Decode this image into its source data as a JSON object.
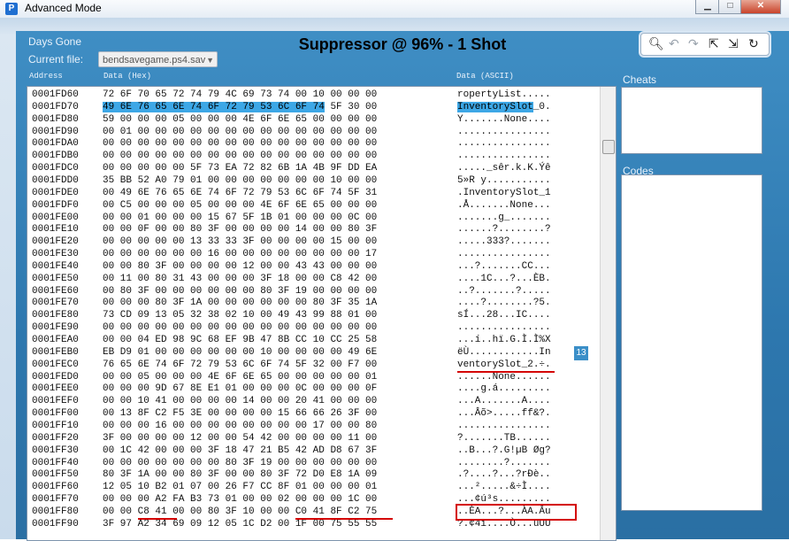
{
  "window": {
    "title": "Advanced Mode",
    "icon": "app-logo-icon"
  },
  "header": {
    "game": "Days Gone",
    "heading": "Suppressor @ 96% - 1 Shot",
    "current_file_label": "Current file:",
    "current_file_value": "bendsavegame.ps4.sav"
  },
  "toolbar": {
    "icons": [
      "search-icon",
      "undo-icon",
      "redo-icon",
      "import-icon",
      "export-icon",
      "refresh-icon"
    ]
  },
  "columns": {
    "address": "Address",
    "hex": "Data (Hex)",
    "ascii": "Data (ASCII)"
  },
  "hex_rows": [
    {
      "addr": "0001FD60",
      "hex": "72 6F 70 65 72 74 79 4C 69 73 74 00 10 00 00 00",
      "ascii": "ropertyList....."
    },
    {
      "addr": "0001FD70",
      "hex": "49 6E 76 65 6E 74 6F 72 79 53 6C 6F 74 5F 30 00",
      "ascii": "InventorySlot_0."
    },
    {
      "addr": "0001FD80",
      "hex": "59 00 00 00 05 00 00 00 4E 6F 6E 65 00 00 00 00",
      "ascii": "Y.......None...."
    },
    {
      "addr": "0001FD90",
      "hex": "00 01 00 00 00 00 00 00 00 00 00 00 00 00 00 00",
      "ascii": "................"
    },
    {
      "addr": "0001FDA0",
      "hex": "00 00 00 00 00 00 00 00 00 00 00 00 00 00 00 00",
      "ascii": "................"
    },
    {
      "addr": "0001FDB0",
      "hex": "00 00 00 00 00 00 00 00 00 00 00 00 00 00 00 00",
      "ascii": "................"
    },
    {
      "addr": "0001FDC0",
      "hex": "00 00 00 00 00 5F 73 EA 72 82 6B 1A 4B 9F DD EA",
      "ascii": "....._sêr.k.K.Ýê"
    },
    {
      "addr": "0001FDD0",
      "hex": "35 BB 52 A0 79 01 00 00 00 00 00 00 00 10 00 00",
      "ascii": "5»R y..........."
    },
    {
      "addr": "0001FDE0",
      "hex": "00 49 6E 76 65 6E 74 6F 72 79 53 6C 6F 74 5F 31",
      "ascii": ".InventorySlot_1"
    },
    {
      "addr": "0001FDF0",
      "hex": "00 C5 00 00 00 05 00 00 00 4E 6F 6E 65 00 00 00",
      "ascii": ".Å.......None..."
    },
    {
      "addr": "0001FE00",
      "hex": "00 00 01 00 00 00 15 67 5F 1B 01 00 00 00 0C 00",
      "ascii": ".......g_......."
    },
    {
      "addr": "0001FE10",
      "hex": "00 00 0F 00 00 80 3F 00 00 00 00 14 00 00 80 3F",
      "ascii": "......?........?"
    },
    {
      "addr": "0001FE20",
      "hex": "00 00 00 00 00 13 33 33 3F 00 00 00 00 15 00 00",
      "ascii": ".....333?......."
    },
    {
      "addr": "0001FE30",
      "hex": "00 00 00 00 00 00 16 00 00 00 00 00 00 00 00 17",
      "ascii": "................"
    },
    {
      "addr": "0001FE40",
      "hex": "00 00 80 3F 00 00 00 00 12 00 00 43 43 00 00 00",
      "ascii": "...?.......CC..."
    },
    {
      "addr": "0001FE50",
      "hex": "00 11 00 80 31 43 00 00 00 3F 18 00 00 C8 42 00",
      "ascii": "....1C...?...ÈB."
    },
    {
      "addr": "0001FE60",
      "hex": "00 80 3F 00 00 00 00 00 00 80 3F 19 00 00 00 00",
      "ascii": "..?.......?....."
    },
    {
      "addr": "0001FE70",
      "hex": "00 00 00 80 3F 1A 00 00 00 00 00 00 80 3F 35 1A",
      "ascii": "....?........?5."
    },
    {
      "addr": "0001FE80",
      "hex": "73 CD 09 13 05 32 38 02 10 00 49 43 99 88 01 00",
      "ascii": "sÍ...28...IC...."
    },
    {
      "addr": "0001FE90",
      "hex": "00 00 00 00 00 00 00 00 00 00 00 00 00 00 00 00",
      "ascii": "................"
    },
    {
      "addr": "0001FEA0",
      "hex": "00 00 04 ED 98 9C 68 EF 9B 47 8B CC 10 CC 25 58",
      "ascii": "...í..hï.G.Ì.Ì%X"
    },
    {
      "addr": "0001FEB0",
      "hex": "EB D9 01 00 00 00 00 00 00 10 00 00 00 00 49 6E",
      "ascii": "ëÙ............In"
    },
    {
      "addr": "0001FEC0",
      "hex": "76 65 6E 74 6F 72 79 53 6C 6F 74 5F 32 00 F7 00",
      "ascii": "ventorySlot_2.÷."
    },
    {
      "addr": "0001FED0",
      "hex": "00 00 05 00 00 00 4E 6F 6E 65 00 00 00 00 00 01",
      "ascii": "......None......"
    },
    {
      "addr": "0001FEE0",
      "hex": "00 00 00 9D 67 8E E1 01 00 00 00 0C 00 00 00 0F",
      "ascii": "....g.á........."
    },
    {
      "addr": "0001FEF0",
      "hex": "00 00 10 41 00 00 00 00 14 00 00 20 41 00 00 00",
      "ascii": "...A.......A...."
    },
    {
      "addr": "0001FF00",
      "hex": "00 13 8F C2 F5 3E 00 00 00 00 15 66 66 26 3F 00",
      "ascii": "...Âõ>.....ff&?."
    },
    {
      "addr": "0001FF10",
      "hex": "00 00 00 16 00 00 00 00 00 00 00 00 17 00 00 80",
      "ascii": "................"
    },
    {
      "addr": "0001FF20",
      "hex": "3F 00 00 00 00 12 00 00 54 42 00 00 00 00 11 00",
      "ascii": "?.......TB......"
    },
    {
      "addr": "0001FF30",
      "hex": "00 1C 42 00 00 00 3F 18 47 21 B5 42 AD D8 67 3F",
      "ascii": "..B...?.G!µB Øg?"
    },
    {
      "addr": "0001FF40",
      "hex": "00 00 00 00 00 00 00 80 3F 19 00 00 00 00 00 00",
      "ascii": "........?......."
    },
    {
      "addr": "0001FF50",
      "hex": "80 3F 1A 00 00 80 3F 00 00 80 3F 72 D0 E8 1A 09",
      "ascii": ".?....?...?rÐè.."
    },
    {
      "addr": "0001FF60",
      "hex": "12 05 10 B2 01 07 00 26 F7 CC 8F 01 00 00 00 01",
      "ascii": "...².....&÷Ì...."
    },
    {
      "addr": "0001FF70",
      "hex": "00 00 00 A2 FA B3 73 01 00 00 02 00 00 00 1C 00",
      "ascii": "...¢ú³s........."
    },
    {
      "addr": "0001FF80",
      "hex": "00 00 C8 41 00 00 80 3F 10 00 00 C0 41 8F C2 75",
      "ascii": "..ÈA...?...ÀA.Âu"
    },
    {
      "addr": "0001FF90",
      "hex": "3F 97 A2 34 69 09 12 05 1C D2 00 1F 00 75 55 55",
      "ascii": "?.¢4i....Ò...uUU"
    }
  ],
  "badge": "13",
  "side": {
    "cheats_label": "Cheats",
    "codes_label": "Codes"
  },
  "colors": {
    "accent": "#2d77ae",
    "highlight": "#3da7e6",
    "annotation": "#d40000"
  }
}
